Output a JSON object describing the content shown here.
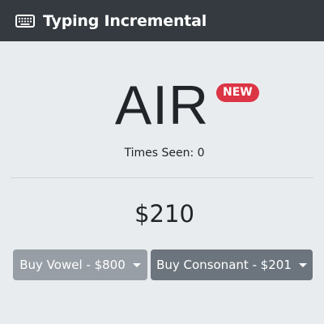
{
  "header": {
    "icon": "keyboard-icon",
    "title": "Typing Incremental"
  },
  "main": {
    "word": "AIR",
    "badge": "NEW",
    "times_seen": "Times Seen: 0",
    "money": "$210",
    "buy_vowel_label": "Buy Vowel - $800",
    "buy_consonant_label": "Buy Consonant - $201"
  },
  "colors": {
    "navbar": "#343a40",
    "background": "#e9ecef",
    "badge": "#dc3545",
    "buy_vowel_button": "#979ea5",
    "buy_consonant_button": "#6c757d"
  }
}
